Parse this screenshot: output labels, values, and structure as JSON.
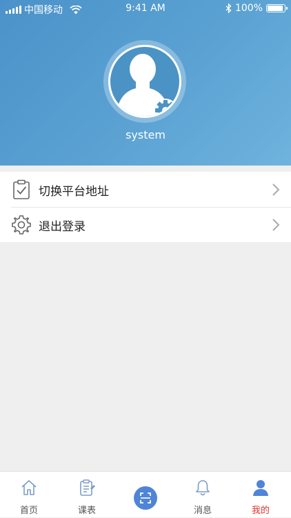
{
  "status_bar": {
    "carrier": "中国移动",
    "time": "9:41 AM",
    "battery": "100%",
    "battery_level": 1.0,
    "icons": [
      "signal-icon",
      "wifi-icon",
      "bluetooth-icon",
      "battery-icon"
    ]
  },
  "profile": {
    "username": "system",
    "avatar_icon": "user-settings-avatar-icon"
  },
  "menu": {
    "items": [
      {
        "label": "切换平台地址",
        "icon": "clipboard-check-icon"
      },
      {
        "label": "退出登录",
        "icon": "gear-icon"
      }
    ]
  },
  "tabbar": {
    "tabs": [
      {
        "label": "首页",
        "icon": "home-icon"
      },
      {
        "label": "课表",
        "icon": "schedule-icon"
      },
      {
        "label": "",
        "icon": "scan-icon"
      },
      {
        "label": "消息",
        "icon": "bell-icon"
      },
      {
        "label": "我的",
        "icon": "user-icon",
        "active": true
      }
    ]
  },
  "colors": {
    "header_gradient_start": "#4a92c9",
    "header_gradient_end": "#6fb3de",
    "active_tab": "#e0342d",
    "scan_button": "#4f84d8",
    "background": "#efefef"
  }
}
